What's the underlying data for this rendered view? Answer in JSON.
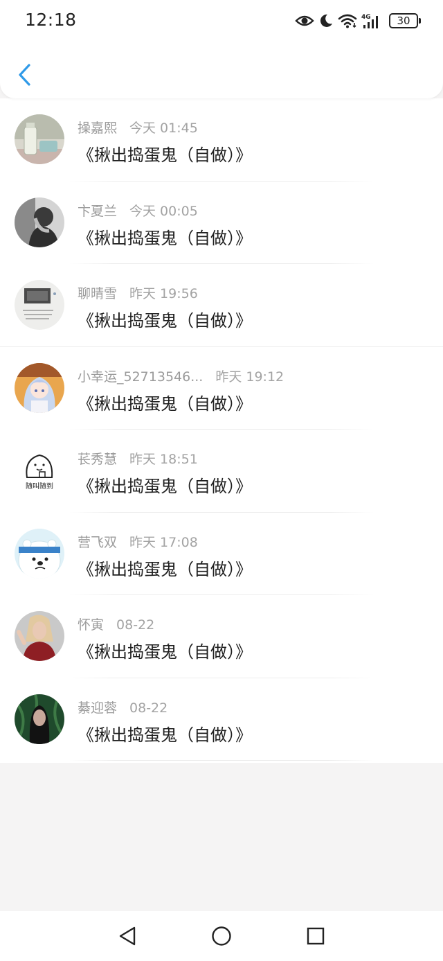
{
  "status_bar": {
    "time": "12:18",
    "network": "4G",
    "battery": "30",
    "icons": [
      "eye-icon",
      "moon-icon",
      "wifi-icon",
      "signal-4g-icon",
      "battery-icon"
    ]
  },
  "header": {
    "back_icon": "chevron-left-icon",
    "accent_color": "#2f9ae8"
  },
  "messages": [
    {
      "name": "操嘉熙",
      "time": "今天 01:45",
      "title": "《揪出捣蛋鬼（自做）》",
      "avatar": "photo-glass-jar"
    },
    {
      "name": "卞夏兰",
      "time": "今天 00:05",
      "title": "《揪出捣蛋鬼（自做）》",
      "avatar": "photo-sad-person"
    },
    {
      "name": "聊晴雪",
      "time": "昨天 19:56",
      "title": "《揪出捣蛋鬼（自做）》",
      "avatar": "photo-note-card"
    },
    {
      "name": "小幸运_52713546...",
      "time": "昨天 19:12",
      "title": "《揪出捣蛋鬼（自做）》",
      "avatar": "anime-girl"
    },
    {
      "name": "苌秀慧",
      "time": "昨天 18:51",
      "title": "《揪出捣蛋鬼（自做）》",
      "avatar": "doodle-sticker",
      "avatar_text": "随叫随到"
    },
    {
      "name": "营飞双",
      "time": "昨天 17:08",
      "title": "《揪出捣蛋鬼（自做）》",
      "avatar": "cartoon-polar-bear"
    },
    {
      "name": "怀寅",
      "time": "08-22",
      "title": "《揪出捣蛋鬼（自做）》",
      "avatar": "photo-woman-blonde"
    },
    {
      "name": "綦迎蓉",
      "time": "08-22",
      "title": "《揪出捣蛋鬼（自做）》",
      "avatar": "photo-woman-foliage"
    }
  ],
  "nav_bar": {
    "buttons": [
      "back-triangle-icon",
      "home-circle-icon",
      "recents-square-icon"
    ]
  }
}
